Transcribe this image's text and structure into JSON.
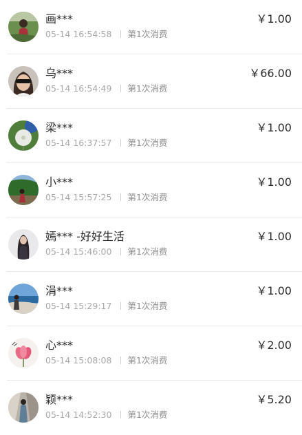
{
  "records": [
    {
      "name": "画***",
      "time": "05-14 16:54:58",
      "count": "第1次消费",
      "amount": "￥1.00",
      "avatar": "avatar-icon"
    },
    {
      "name": "乌***",
      "time": "05-14 16:54:49",
      "count": "第1次消费",
      "amount": "￥66.00",
      "avatar": "avatar-icon"
    },
    {
      "name": "梁***",
      "time": "05-14 16:37:57",
      "count": "第1次消费",
      "amount": "￥1.00",
      "avatar": "avatar-icon"
    },
    {
      "name": "小***",
      "time": "05-14 15:57:25",
      "count": "第1次消费",
      "amount": "￥1.00",
      "avatar": "avatar-icon"
    },
    {
      "name": "嫣*** -好好生活",
      "time": "05-14 15:46:00",
      "count": "第1次消费",
      "amount": "￥1.00",
      "avatar": "avatar-icon"
    },
    {
      "name": "涓***",
      "time": "05-14 15:29:17",
      "count": "第1次消费",
      "amount": "￥1.00",
      "avatar": "avatar-icon"
    },
    {
      "name": "心***",
      "time": "05-14 15:08:08",
      "count": "第1次消费",
      "amount": "￥2.00",
      "avatar": "avatar-icon"
    },
    {
      "name": "颖***",
      "time": "05-14 14:52:30",
      "count": "第1次消费",
      "amount": "￥5.20",
      "avatar": "avatar-icon"
    }
  ]
}
